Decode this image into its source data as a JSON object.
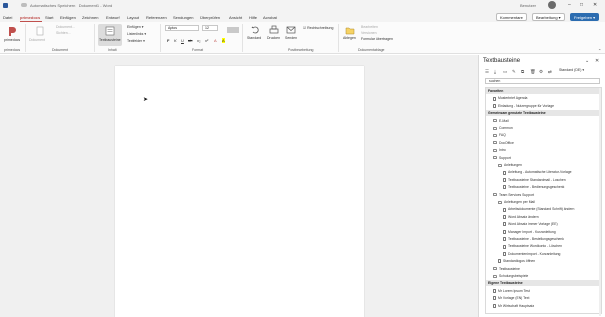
{
  "titlebar": {
    "title": "Dokument1 - Word",
    "autosave_label": "Automatisches Speichern",
    "user": "Benutzer",
    "minimize": "–",
    "maximize": "□",
    "close": "✕"
  },
  "tabs": [
    "Datei",
    "primedocs",
    "Start",
    "Einfügen",
    "Zeichnen",
    "Entwurf",
    "Layout",
    "Referenzen",
    "Sendungen",
    "Überprüfen",
    "Ansicht",
    "Hilfe",
    "Acrobat"
  ],
  "tab_actions": {
    "comments": "Kommentare",
    "editing": "Bearbeitung ▾",
    "share": "Freigeben ▾"
  },
  "ribbon": {
    "groups": {
      "primedocs": "primedocs",
      "dokument": "Dokument",
      "inhalt": "Inhalt",
      "format": "Format",
      "postbearbeitung": "Postbearbeitung",
      "dokumentablage": "Dokumentablage"
    },
    "primedocs_btn": "primedocs",
    "dokument_btn": "Dokument",
    "dokument_items": [
      "Dokument...",
      "Sichten..."
    ],
    "textbausteine_btn": "Textbausteine",
    "inhalt_items": [
      "Einfügen ▾",
      "Listenlinks ▾",
      "Textfelder ▾"
    ],
    "font": "Aptos",
    "font_size": "12",
    "format_glyphs": [
      "F",
      "K",
      "U",
      "ab",
      "x₂",
      "x²",
      "A",
      "A"
    ],
    "standard_btn": "Standard",
    "drucken_btn": "Drucken",
    "senden_btn": "Senden",
    "rechtschreibung": "Rechtschreibung",
    "ablegen_btn": "Ablegen",
    "dokumentablage_items": [
      "Bearbeiten",
      "Versionen",
      "Formular übertragen"
    ]
  },
  "pane": {
    "title": "Textbausteine",
    "dropdown": "Standard (DE)",
    "search_value": "suchen",
    "rows": [
      {
        "type": "header",
        "label": "Favoriten",
        "indent": 0
      },
      {
        "type": "doc",
        "label": "Musterbrief Agenda",
        "indent": 1
      },
      {
        "type": "doc",
        "label": "Einladung - Nutzergruppe für Vorlage",
        "indent": 1
      },
      {
        "type": "header",
        "label": "Gemeinsam genutzte Textbausteine",
        "indent": 0
      },
      {
        "type": "folder",
        "label": "E-Mail",
        "indent": 1
      },
      {
        "type": "folder",
        "label": "Common",
        "indent": 1
      },
      {
        "type": "folder",
        "label": "FAQ",
        "indent": 1
      },
      {
        "type": "folder",
        "label": "DocOffice",
        "indent": 1
      },
      {
        "type": "folder",
        "label": "Intro",
        "indent": 1
      },
      {
        "type": "folder",
        "label": "Support",
        "indent": 1
      },
      {
        "type": "folder",
        "label": "Anleitungen",
        "indent": 2
      },
      {
        "type": "doc",
        "label": "Anleitung - Automatische Literatur-Vorlage",
        "indent": 3
      },
      {
        "type": "doc",
        "label": "Textbausteine Standardmail - Loschen",
        "indent": 3
      },
      {
        "type": "doc",
        "label": "Textbausteine - Bedienungsgeschenk",
        "indent": 3
      },
      {
        "type": "folder",
        "label": "Team Services Support",
        "indent": 1
      },
      {
        "type": "folder",
        "label": "Anleitungen per Mail",
        "indent": 2
      },
      {
        "type": "doc",
        "label": "Arbeitsdokumente (Standard Schrift) ändern",
        "indent": 3
      },
      {
        "type": "doc",
        "label": "Word Absatz ändern",
        "indent": 3
      },
      {
        "type": "doc",
        "label": "Word Absatz immer Vorlage (EE)",
        "indent": 3
      },
      {
        "type": "doc",
        "label": "Manager Import - Kurzanleitung",
        "indent": 3
      },
      {
        "type": "doc",
        "label": "Textbausteine - Bestellungsgeschenk",
        "indent": 3
      },
      {
        "type": "doc",
        "label": "Textbausteine Wordkonto - Löschen",
        "indent": 3
      },
      {
        "type": "doc",
        "label": "Dokumentenimport - Kurzanleitung",
        "indent": 3
      },
      {
        "type": "doc",
        "label": "Standardlogos öffnen",
        "indent": 2
      },
      {
        "type": "folder",
        "label": "Testbausteine",
        "indent": 1
      },
      {
        "type": "folder",
        "label": "Schulungsbeispiele",
        "indent": 1
      },
      {
        "type": "header",
        "label": "Eigene Textbausteine",
        "indent": 0
      },
      {
        "type": "doc",
        "label": "Mr Lorem Ipsum Test",
        "indent": 1
      },
      {
        "type": "doc",
        "label": "Mr Vorlage (EN) Text",
        "indent": 1
      },
      {
        "type": "doc",
        "label": "Mr Wirtschaft Hauptsatz",
        "indent": 1
      }
    ]
  },
  "colors": {
    "accent": "#c0504d",
    "share": "#2b6cb0"
  }
}
